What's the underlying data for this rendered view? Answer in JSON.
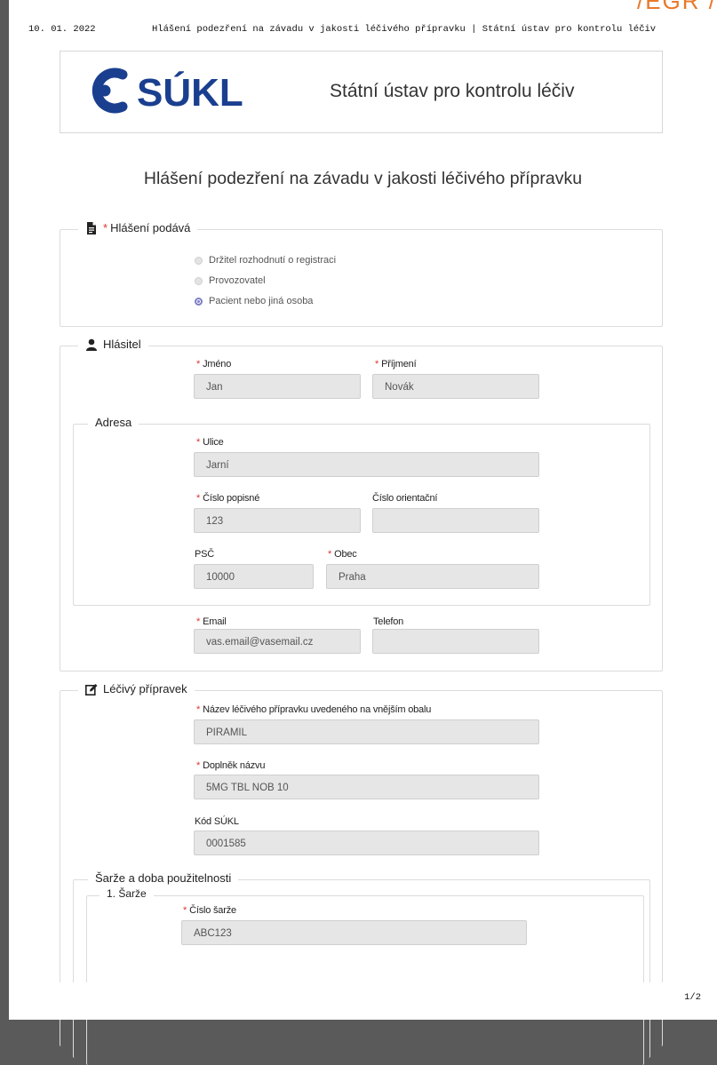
{
  "corner_text": "/EGR /",
  "print_header": {
    "date": "10. 01. 2022",
    "title": "Hlášení podezření na závadu v jakosti léčivého přípravku | Státní ústav pro kontrolu léčiv"
  },
  "page_number": "1/2",
  "brand": {
    "logo_text": "SÚKL",
    "name": "Státní ústav pro kontrolu léčiv"
  },
  "main_title": "Hlášení podezření na závadu v jakosti léčivého přípravku",
  "reporter_type": {
    "legend": "Hlášení podává",
    "options": [
      {
        "label": "Držitel rozhodnutí o registraci",
        "selected": false
      },
      {
        "label": "Provozovatel",
        "selected": false
      },
      {
        "label": "Pacient nebo jiná osoba",
        "selected": true
      }
    ]
  },
  "reporter": {
    "legend": "Hlásitel",
    "first_name_label": "Jméno",
    "first_name": "Jan",
    "last_name_label": "Příjmení",
    "last_name": "Novák",
    "address": {
      "legend": "Adresa",
      "street_label": "Ulice",
      "street": "Jarní",
      "house_number_label": "Číslo popisné",
      "house_number": "123",
      "orientation_number_label": "Číslo orientační",
      "orientation_number": "",
      "zip_label": "PSČ",
      "zip": "10000",
      "city_label": "Obec",
      "city": "Praha"
    },
    "email_label": "Email",
    "email": "vas.email@vasemail.cz",
    "phone_label": "Telefon",
    "phone": ""
  },
  "product": {
    "legend": "Léčivý přípravek",
    "name_label": "Název léčivého přípravku uvedeného na vnějším obalu",
    "name": "PIRAMIL",
    "supplement_label": "Doplněk názvu",
    "supplement": "5MG TBL NOB 10",
    "sukl_code_label": "Kód SÚKL",
    "sukl_code": "0001585",
    "batches": {
      "legend": "Šarže a doba použitelnosti",
      "items": [
        {
          "legend": "1. Šarže",
          "batch_label": "Číslo šarže",
          "batch": "ABC123"
        }
      ]
    }
  },
  "colors": {
    "required": "#d9352f",
    "logo_blue": "#1a3f8f",
    "radio_selected": "#7d7fc4",
    "accent_orange": "#e8792a"
  }
}
